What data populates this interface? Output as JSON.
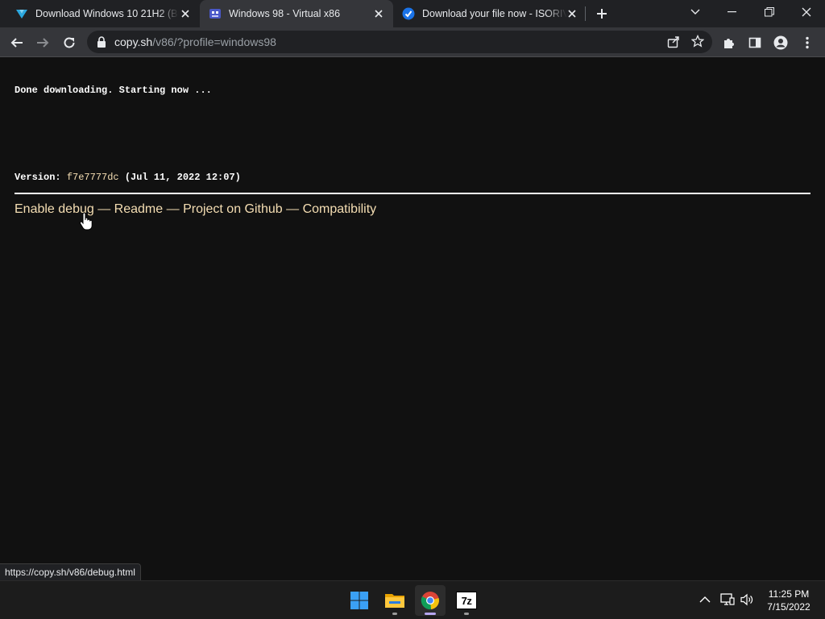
{
  "browser": {
    "tabs": [
      {
        "title": "Download Windows 10 21H2 (Bu",
        "favicon": "download-site-icon",
        "active": false
      },
      {
        "title": "Windows 98 - Virtual x86",
        "favicon": "v86-icon",
        "active": true
      },
      {
        "title": "Download your file now - ISORIV",
        "favicon": "check-badge-icon",
        "active": false
      }
    ],
    "address": {
      "host": "copy.sh",
      "path": "/v86/?profile=windows98"
    }
  },
  "page": {
    "status_text": "Done downloading. Starting now ...",
    "version_label": "Version:",
    "version_hash": "f7e7777dc",
    "version_date": "(Jul 11, 2022 12:07)",
    "links": {
      "debug": "Enable debug",
      "readme": "Readme",
      "github": "Project on Github",
      "compat": "Compatibility",
      "separator": "—"
    },
    "hover_url": "https://copy.sh/v86/debug.html"
  },
  "taskbar": {
    "apps": [
      "windows-start-icon",
      "file-explorer-icon",
      "chrome-icon",
      "7zip-icon"
    ],
    "sevenzip_label": "7z",
    "clock_time": "11:25 PM",
    "clock_date": "7/15/2022"
  },
  "colors": {
    "page_bg": "#111111",
    "link": "#f5deb3",
    "tab_active": "#35363a",
    "tabstrip": "#202124"
  }
}
